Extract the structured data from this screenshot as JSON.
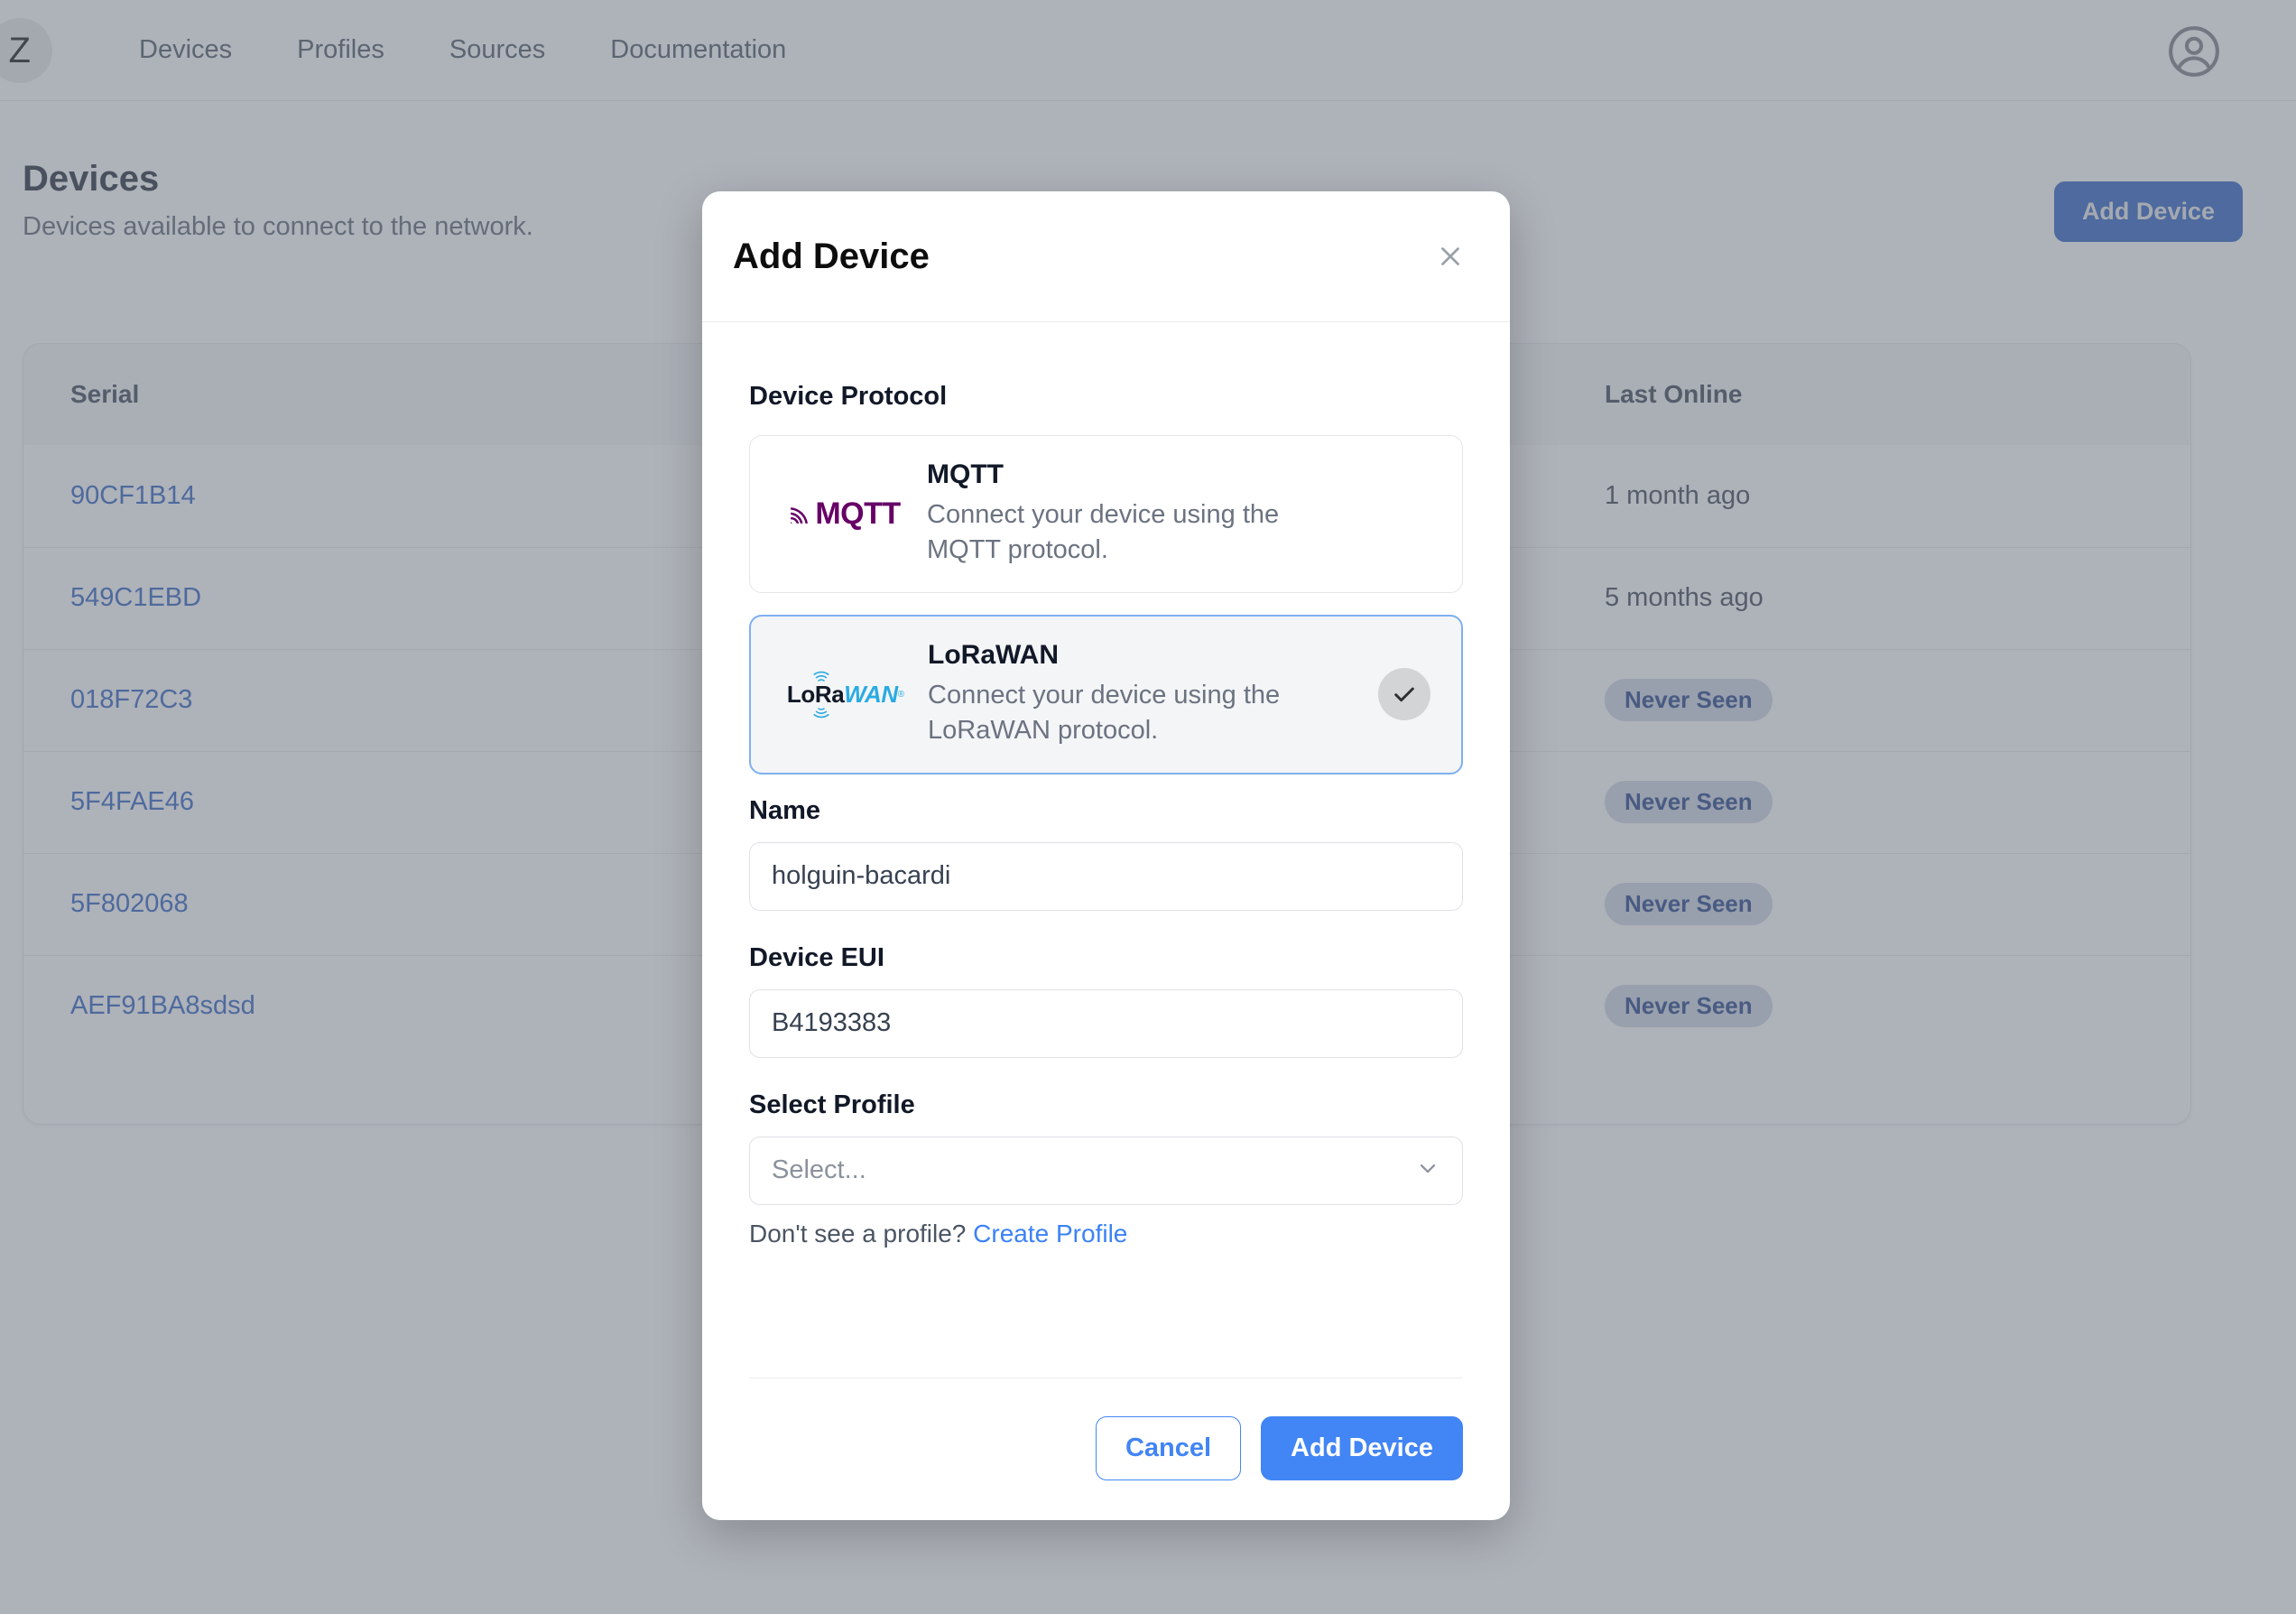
{
  "nav": {
    "logo_text": "Z",
    "links": [
      {
        "label": "Devices"
      },
      {
        "label": "Profiles"
      },
      {
        "label": "Sources"
      },
      {
        "label": "Documentation"
      }
    ],
    "avatar_icon": "user-circle-icon"
  },
  "page": {
    "title": "Devices",
    "subtitle": "Devices available to connect to the network.",
    "add_device_label": "Add Device"
  },
  "table": {
    "columns": [
      {
        "key": "serial",
        "label": "Serial"
      },
      {
        "key": "last_online",
        "label": "Last Online"
      }
    ],
    "rows": [
      {
        "serial": "90CF1B14",
        "last_online": "1 month ago",
        "is_badge": false
      },
      {
        "serial": "549C1EBD",
        "last_online": "5 months ago",
        "is_badge": false
      },
      {
        "serial": "018F72C3",
        "last_online": "Never Seen",
        "is_badge": true
      },
      {
        "serial": "5F4FAE46",
        "last_online": "Never Seen",
        "is_badge": true
      },
      {
        "serial": "5F802068",
        "last_online": "Never Seen",
        "is_badge": true
      },
      {
        "serial": "AEF91BA8sdsd",
        "last_online": "Never Seen",
        "is_badge": true
      }
    ]
  },
  "modal": {
    "title": "Add Device",
    "close_icon": "close-x-icon",
    "protocol_section_label": "Device Protocol",
    "protocols": [
      {
        "id": "mqtt",
        "logo": "mqtt-logo",
        "logo_text": "MQTT",
        "name": "MQTT",
        "description": "Connect your device using the MQTT protocol.",
        "selected": false
      },
      {
        "id": "lorawan",
        "logo": "lorawan-logo",
        "logo_text_a": "LoRa",
        "logo_text_b": "WAN",
        "name": "LoRaWAN",
        "description": "Connect your device using the LoRaWAN protocol.",
        "selected": true,
        "check_icon": "check-icon"
      }
    ],
    "name_field": {
      "label": "Name",
      "value": "holguin-bacardi",
      "placeholder": ""
    },
    "device_eui_field": {
      "label": "Device EUI",
      "value": "B4193383",
      "placeholder": ""
    },
    "profile_field": {
      "label": "Select Profile",
      "placeholder": "Select...",
      "chevron_icon": "chevron-down-icon"
    },
    "profile_hint_prefix": "Don't see a profile? ",
    "profile_hint_link": "Create Profile",
    "cancel_label": "Cancel",
    "submit_label": "Add Device"
  },
  "colors": {
    "accent_blue": "#4285f4",
    "header_button_blue": "#2a5fc4",
    "link_blue": "#2b5fc0",
    "mqtt_purple": "#660066",
    "lorawan_cyan": "#29abe2",
    "badge_bg": "#cfd6e4",
    "badge_text": "#1f3f86"
  }
}
